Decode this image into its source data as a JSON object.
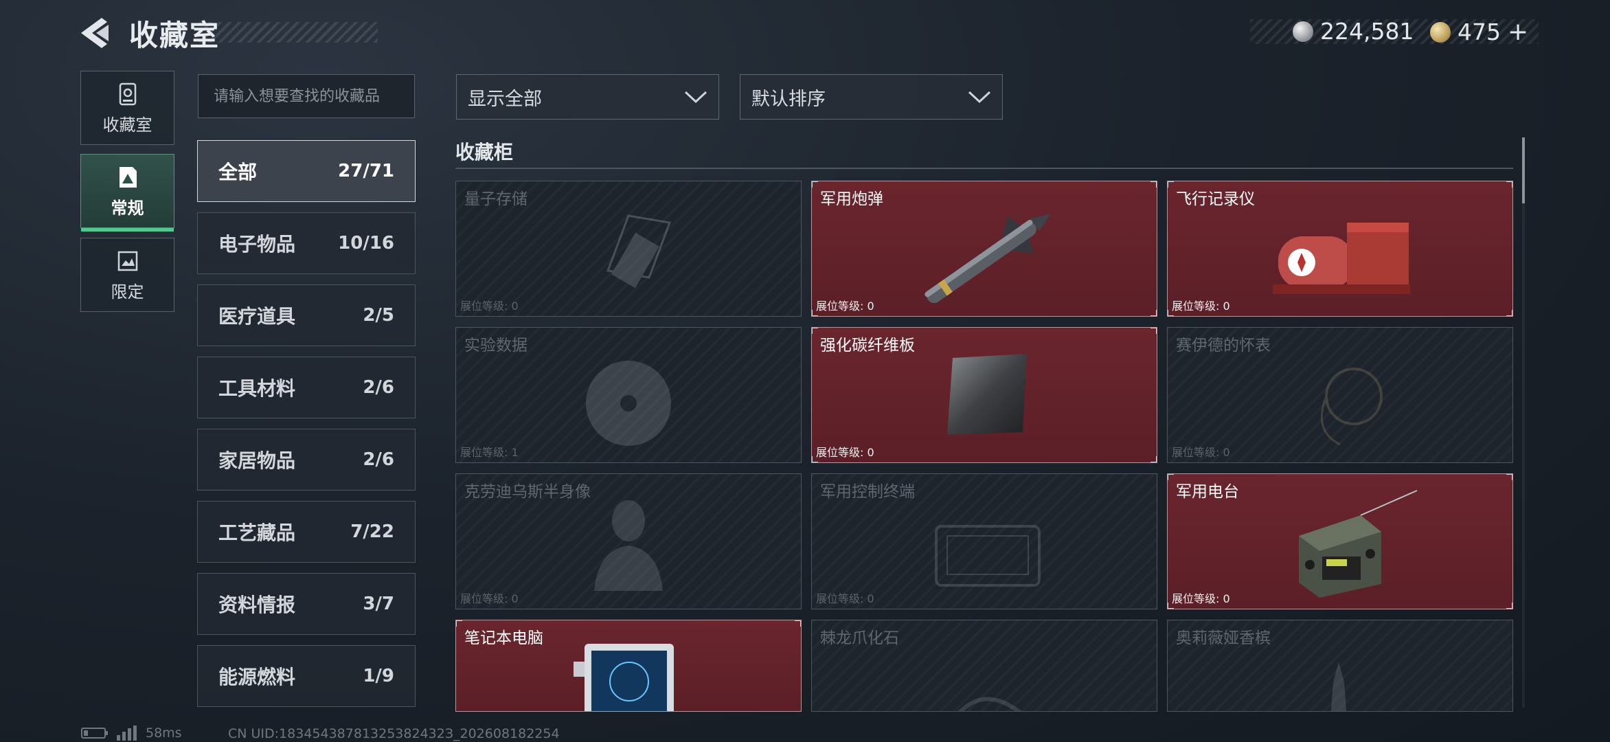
{
  "header": {
    "title": "收藏室",
    "currency": [
      {
        "icon": "silver-coin-icon",
        "value": "224,581"
      },
      {
        "icon": "gold-coin-icon",
        "value": "475",
        "suffix": "+"
      }
    ]
  },
  "nav": [
    {
      "label": "收藏室",
      "icon": "collection-room-icon",
      "active": false
    },
    {
      "label": "常规",
      "icon": "regular-icon",
      "active": true
    },
    {
      "label": "限定",
      "icon": "limited-icon",
      "active": false
    }
  ],
  "search": {
    "placeholder": "请输入想要查找的收藏品"
  },
  "filters": {
    "display": "显示全部",
    "sort": "默认排序"
  },
  "categories": [
    {
      "name": "全部",
      "count": "27/71",
      "active": true
    },
    {
      "name": "电子物品",
      "count": "10/16"
    },
    {
      "name": "医疗道具",
      "count": "2/5"
    },
    {
      "name": "工具材料",
      "count": "2/6"
    },
    {
      "name": "家居物品",
      "count": "2/6"
    },
    {
      "name": "工艺藏品",
      "count": "7/22"
    },
    {
      "name": "资料情报",
      "count": "3/7"
    },
    {
      "name": "能源燃料",
      "count": "1/9"
    }
  ],
  "cabinet": {
    "title": "收藏柜",
    "level_label": "展位等级:",
    "items": [
      {
        "name": "量子存储",
        "level": "0",
        "owned": false,
        "icon": "quantum-storage-icon"
      },
      {
        "name": "军用炮弹",
        "level": "0",
        "owned": true,
        "icon": "military-shell-icon"
      },
      {
        "name": "飞行记录仪",
        "level": "0",
        "owned": true,
        "icon": "flight-recorder-icon"
      },
      {
        "name": "实验数据",
        "level": "1",
        "owned": false,
        "icon": "disc-icon"
      },
      {
        "name": "强化碳纤维板",
        "level": "0",
        "owned": true,
        "icon": "carbon-fiber-plate-icon"
      },
      {
        "name": "赛伊德的怀表",
        "level": "0",
        "owned": false,
        "icon": "pocket-watch-icon"
      },
      {
        "name": "克劳迪乌斯半身像",
        "level": "0",
        "owned": false,
        "icon": "bust-icon"
      },
      {
        "name": "军用控制终端",
        "level": "0",
        "owned": false,
        "icon": "control-terminal-icon"
      },
      {
        "name": "军用电台",
        "level": "0",
        "owned": true,
        "icon": "military-radio-icon"
      },
      {
        "name": "笔记本电脑",
        "level": "",
        "owned": true,
        "icon": "laptop-icon"
      },
      {
        "name": "棘龙爪化石",
        "level": "",
        "owned": false,
        "icon": "claw-fossil-icon"
      },
      {
        "name": "奥莉薇娅香槟",
        "level": "",
        "owned": false,
        "icon": "champagne-icon"
      }
    ]
  },
  "footer": {
    "ping": "58ms",
    "uid": "CN UID:18345438781325382432З_202608182254"
  },
  "colors": {
    "accent": "#4ecb8f",
    "owned_card": "#63222a",
    "background": "#1c232c"
  }
}
